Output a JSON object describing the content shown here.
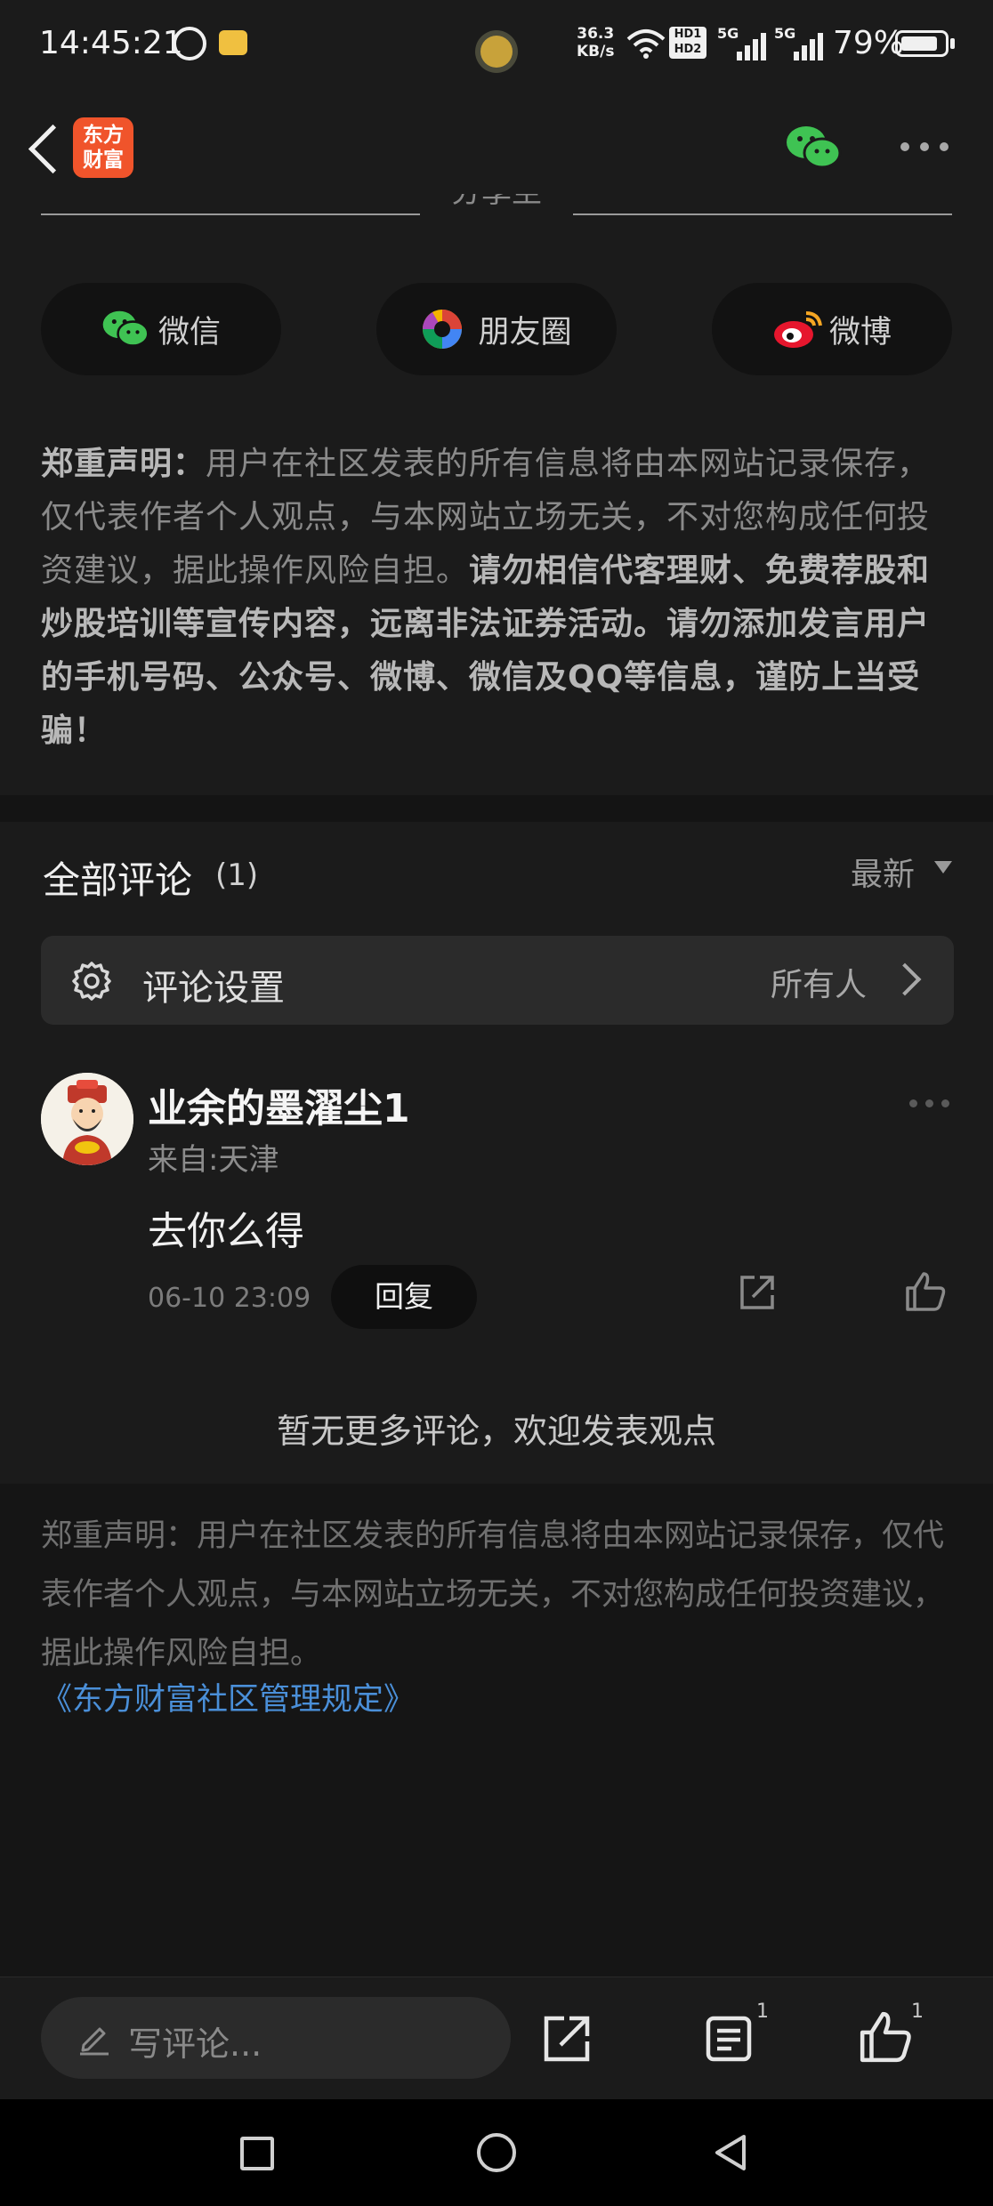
{
  "status_bar": {
    "time": "14:45:21",
    "net_speed_value": "36.3",
    "net_speed_unit": "KB/s",
    "hd1": "HD1",
    "hd2": "HD2",
    "sig1_label": "5G",
    "sig2_label": "5G",
    "battery": "79%"
  },
  "header": {
    "logo_line1": "东方",
    "logo_line2": "财富"
  },
  "share": {
    "title": "分享至",
    "buttons": [
      {
        "label": "微信",
        "icon": "wechat-icon"
      },
      {
        "label": "朋友圈",
        "icon": "moments-icon"
      },
      {
        "label": "微博",
        "icon": "weibo-icon"
      }
    ]
  },
  "notice_top": {
    "lead": "郑重声明：",
    "normal": "用户在社区发表的所有信息将由本网站记录保存，仅代表作者个人观点，与本网站立场无关，不对您构成任何投资建议，据此操作风险自担。",
    "bold": "请勿相信代客理财、免费荐股和炒股培训等宣传内容，远离非法证券活动。请勿添加发言用户的手机号码、公众号、微博、微信及QQ等信息，谨防上当受骗！"
  },
  "comments": {
    "title": "全部评论",
    "count": "(1)",
    "sort_label": "最新",
    "settings_label": "评论设置",
    "settings_value": "所有人",
    "items": [
      {
        "username": "业余的墨濯尘1",
        "location": "来自:天津",
        "text": "去你么得",
        "time": "06-10 23:09",
        "reply_label": "回复"
      }
    ],
    "no_more": "暂无更多评论，欢迎发表观点"
  },
  "footer": {
    "notice": "郑重声明：用户在社区发表的所有信息将由本网站记录保存，仅代表作者个人观点，与本网站立场无关，不对您构成任何投资建议，据此操作风险自担。",
    "rules_link": "《东方财富社区管理规定》"
  },
  "action_bar": {
    "write_placeholder": "写评论...",
    "comments_badge": "1",
    "likes_badge": "1"
  },
  "colors": {
    "background": "#1b1b1b",
    "logo_orange": "#f0542b",
    "link_blue": "#4a8fd8",
    "wechat_green": "#3fc353"
  }
}
